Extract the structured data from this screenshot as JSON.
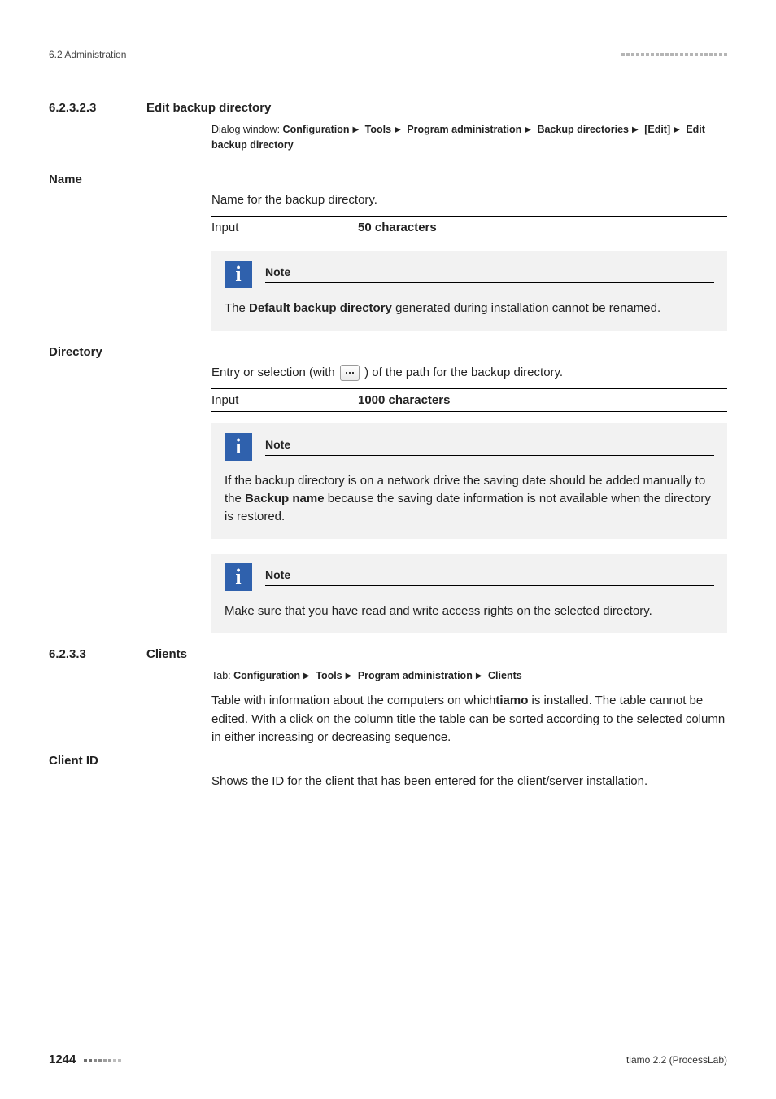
{
  "header": {
    "running_head": "6.2 Administration"
  },
  "section_1": {
    "number": "6.2.3.2.3",
    "title": "Edit backup directory",
    "dialog": {
      "intro": "Dialog window: ",
      "crumbs": [
        "Configuration",
        "Tools",
        "Program administration",
        "Backup directories",
        "[Edit]",
        "Edit backup directory"
      ]
    }
  },
  "name_block": {
    "heading": "Name",
    "desc": "Name for the backup directory.",
    "input_label": "Input",
    "input_value": "50 characters",
    "note": {
      "title": "Note",
      "body_pre": "The ",
      "body_bold": "Default backup directory",
      "body_post": " generated during installation cannot be renamed."
    }
  },
  "directory_block": {
    "heading": "Directory",
    "desc_pre": "Entry or selection (with ",
    "desc_post": ") of the path for the backup directory.",
    "input_label": "Input",
    "input_value": "1000 characters",
    "note1": {
      "title": "Note",
      "body_pre": "If the backup directory is on a network drive the saving date should be added manually to the ",
      "body_bold": "Backup name",
      "body_post": " because the saving date information is not available when the directory is restored."
    },
    "note2": {
      "title": "Note",
      "body": "Make sure that you have read and write access rights on the selected directory."
    }
  },
  "section_2": {
    "number": "6.2.3.3",
    "title": "Clients",
    "tab": {
      "intro": "Tab: ",
      "crumbs": [
        "Configuration",
        "Tools",
        "Program administration",
        "Clients"
      ]
    },
    "body_pre": "Table with information about the computers on which",
    "body_bold": "tiamo",
    "body_post": " is installed. The table cannot be edited. With a click on the column title the table can be sorted according to the selected column in either increasing or decreasing sequence."
  },
  "client_id_block": {
    "heading": "Client ID",
    "body": "Shows the ID for the client that has been entered for the client/server installation."
  },
  "footer": {
    "page_number": "1244",
    "product": "tiamo 2.2 (ProcessLab)"
  }
}
